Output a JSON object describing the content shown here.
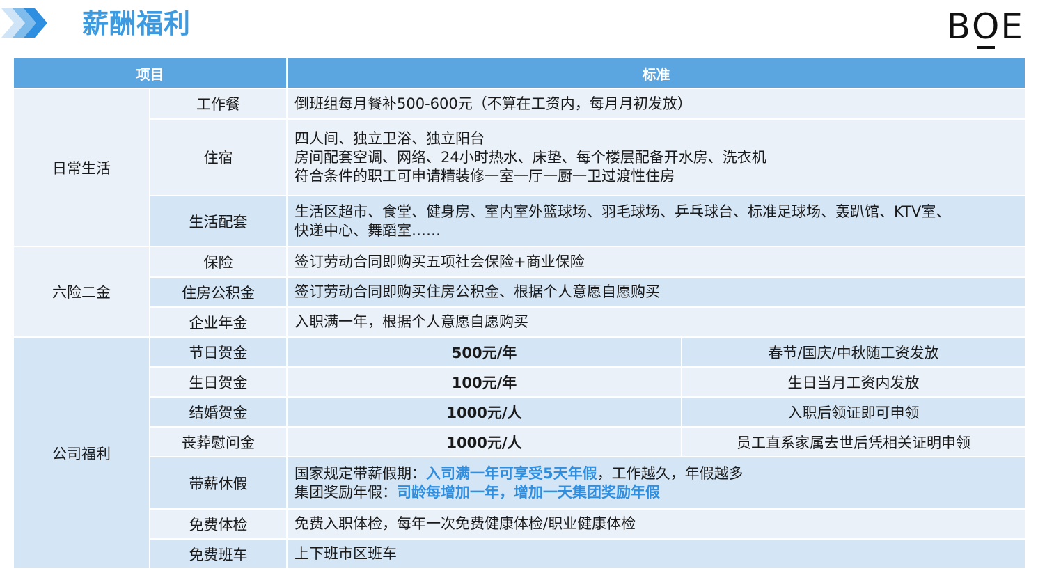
{
  "page": {
    "title": "薪酬福利",
    "logo": "BOE"
  },
  "colors": {
    "header_bg": "#5ba5e0",
    "row_light": "#eaf1f9",
    "row_mid": "#d4e5f5",
    "highlight": "#2e8ee0",
    "title": "#3c9ae0"
  },
  "table": {
    "headers": [
      "项目",
      "标准"
    ],
    "groups": [
      {
        "category": "日常生活",
        "rows": [
          {
            "item": "工作餐",
            "lines": [
              "倒班组每月餐补500-600元（不算在工资内，每月月初发放）"
            ]
          },
          {
            "item": "住宿",
            "lines": [
              "四人间、独立卫浴、独立阳台",
              "房间配套空调、网络、24小时热水、床垫、每个楼层配备开水房、洗衣机",
              "符合条件的职工可申请精装修一室一厅一厨一卫过渡性住房"
            ]
          },
          {
            "item": "生活配套",
            "lines": [
              "生活区超市、食堂、健身房、室内室外篮球场、羽毛球场、乒乓球台、标准足球场、轰趴馆、KTV室、",
              "快递中心、舞蹈室……"
            ]
          }
        ]
      },
      {
        "category": "六险二金",
        "rows": [
          {
            "item": "保险",
            "lines": [
              "签订劳动合同即购买五项社会保险+商业保险"
            ]
          },
          {
            "item": "住房公积金",
            "lines": [
              "签订劳动合同即购买住房公积金、根据个人意愿自愿购买"
            ]
          },
          {
            "item": "企业年金",
            "lines": [
              "入职满一年，根据个人意愿自愿购买"
            ]
          }
        ]
      },
      {
        "category": "公司福利",
        "rows": [
          {
            "item": "节日贺金",
            "amount": "500元/年",
            "note": "春节/国庆/中秋随工资发放"
          },
          {
            "item": "生日贺金",
            "amount": "100元/年",
            "note": "生日当月工资内发放"
          },
          {
            "item": "结婚贺金",
            "amount": "1000元/人",
            "note": "入职后领证即可申领"
          },
          {
            "item": "丧葬慰问金",
            "amount": "1000元/人",
            "note": "员工直系家属去世后凭相关证明申领"
          },
          {
            "item": "带薪休假",
            "line1": {
              "prefix": "国家规定带薪假期：",
              "highlight": "入司满一年可享受5天年假",
              "suffix": "，工作越久，年假越多"
            },
            "line2": {
              "prefix": "集团奖励年假：",
              "highlight": "司龄每增加一年，增加一天集团奖励年假"
            }
          },
          {
            "item": "免费体检",
            "lines": [
              "免费入职体检，每年一次免费健康体检/职业健康体检"
            ]
          },
          {
            "item": "免费班车",
            "lines": [
              "上下班市区班车"
            ]
          }
        ]
      }
    ]
  }
}
